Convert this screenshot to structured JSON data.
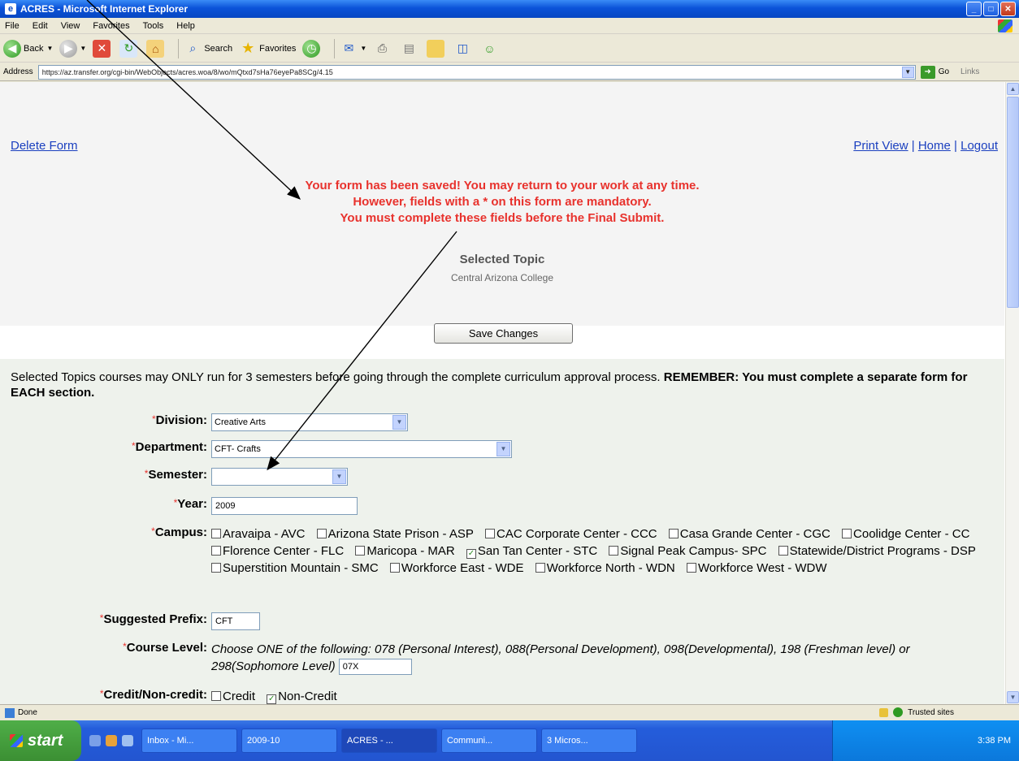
{
  "window": {
    "title": "ACRES - Microsoft Internet Explorer",
    "menu": [
      "File",
      "Edit",
      "View",
      "Favorites",
      "Tools",
      "Help"
    ],
    "toolbar": {
      "back": "Back",
      "search": "Search",
      "favorites": "Favorites"
    },
    "address": {
      "label": "Address",
      "url": "https://az.transfer.org/cgi-bin/WebObjects/acres.woa/8/wo/mQtxd7sHa76eyePa8SCg/4.15",
      "go": "Go",
      "links": "Links"
    },
    "status": {
      "left": "Done",
      "zone": "Trusted sites"
    }
  },
  "page": {
    "delete_link": "Delete Form",
    "print_link": "Print View",
    "home_link": "Home",
    "logout_link": "Logout",
    "separator": "|",
    "notice": [
      "Your form has been saved! You may return to your work at any time.",
      "However, fields with a * on this form are mandatory.",
      "You must complete these fields before the Final Submit."
    ],
    "topic_title": "Selected Topic",
    "topic_sub": "Central Arizona College",
    "save_button": "Save Changes",
    "intro_text": "Selected Topics courses may ONLY run for 3 semesters before going through the complete curriculum approval process.",
    "intro_bold": "REMEMBER: You must complete a separate form for EACH section.",
    "required_mark": "*",
    "fields": {
      "division": {
        "label": "Division:",
        "value": "Creative Arts"
      },
      "department": {
        "label": "Department:",
        "value": "CFT- Crafts"
      },
      "semester": {
        "label": "Semester:",
        "value": ""
      },
      "year": {
        "label": "Year:",
        "value": "2009"
      },
      "campus": {
        "label": "Campus:",
        "options": [
          {
            "text": "Aravaipa - AVC",
            "checked": false
          },
          {
            "text": "Arizona State Prison - ASP",
            "checked": false
          },
          {
            "text": "CAC Corporate Center - CCC",
            "checked": false
          },
          {
            "text": "Casa Grande Center - CGC",
            "checked": false
          },
          {
            "text": "Coolidge Center - CC",
            "checked": false
          },
          {
            "text": "Florence Center - FLC",
            "checked": false
          },
          {
            "text": "Maricopa - MAR",
            "checked": false
          },
          {
            "text": "San Tan Center - STC",
            "checked": true
          },
          {
            "text": "Signal Peak Campus- SPC",
            "checked": false
          },
          {
            "text": "Statewide/District Programs - DSP",
            "checked": false
          },
          {
            "text": "Superstition Mountain - SMC",
            "checked": false
          },
          {
            "text": "Workforce East - WDE",
            "checked": false
          },
          {
            "text": "Workforce North - WDN",
            "checked": false
          },
          {
            "text": "Workforce West - WDW",
            "checked": false
          }
        ]
      },
      "prefix": {
        "label": "Suggested Prefix:",
        "value": "CFT"
      },
      "course_level": {
        "label": "Course Level:",
        "instructions": "Choose ONE of the following: 078 (Personal Interest), 088(Personal Development), 098(Developmental), 198 (Freshman level) or 298(Sophomore Level)",
        "value": "07X"
      },
      "credit": {
        "label": "Credit/Non-credit:",
        "options": [
          {
            "text": "Credit",
            "checked": false
          },
          {
            "text": "Non-Credit",
            "checked": true
          }
        ]
      }
    }
  },
  "taskbar": {
    "start": "start",
    "tasks": [
      "Inbox - Mi...",
      "2009-10",
      "ACRES - ...",
      "Communi...",
      "3 Micros..."
    ],
    "clock": "3:38 PM"
  }
}
